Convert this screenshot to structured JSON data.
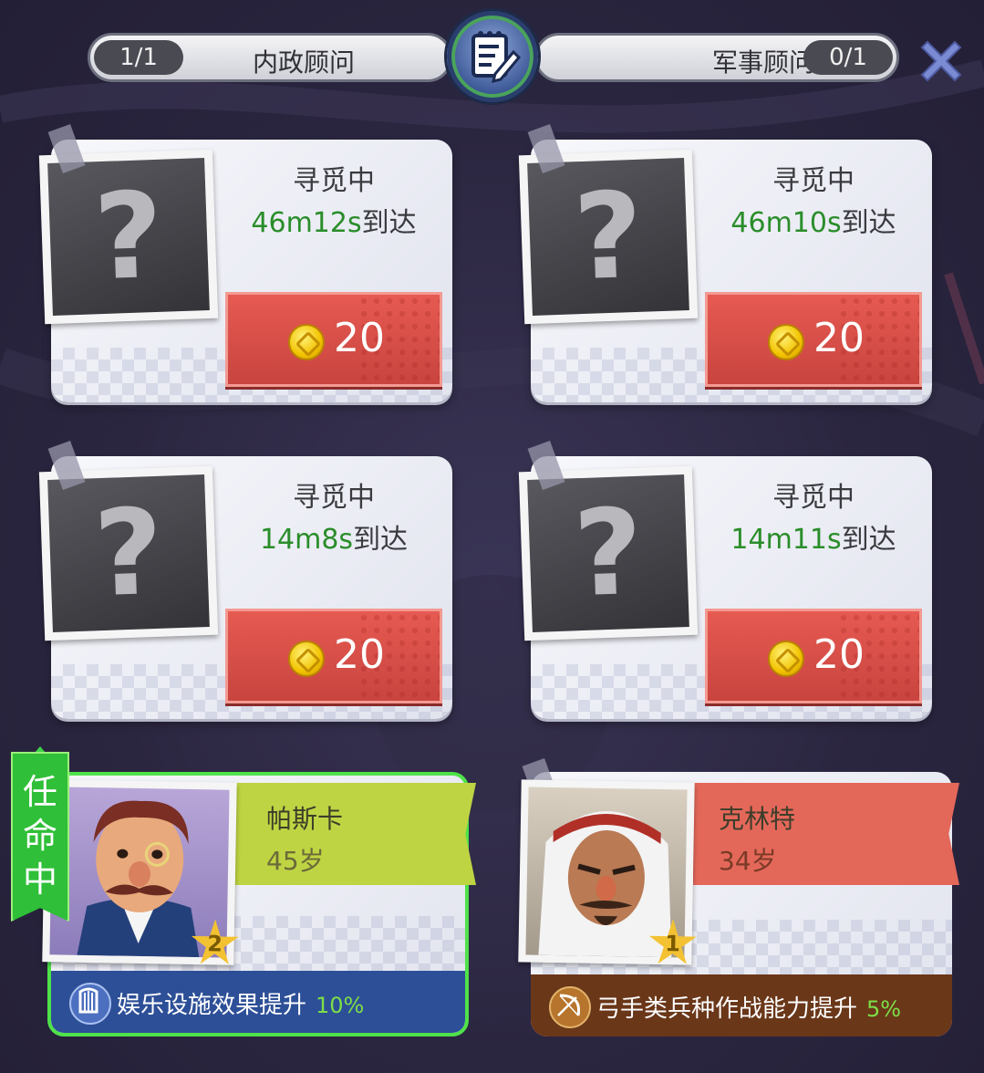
{
  "header": {
    "left_count": "1/1",
    "left_label": "内政顾问",
    "right_label": "军事顾问",
    "right_count": "0/1"
  },
  "search_slots": [
    {
      "status": "寻觅中",
      "time": "46m12s",
      "suffix": "到达",
      "cost": "20"
    },
    {
      "status": "寻觅中",
      "time": "46m10s",
      "suffix": "到达",
      "cost": "20"
    },
    {
      "status": "寻觅中",
      "time": "14m8s",
      "suffix": "到达",
      "cost": "20"
    },
    {
      "status": "寻觅中",
      "time": "14m11s",
      "suffix": "到达",
      "cost": "20"
    }
  ],
  "advisors": [
    {
      "name": "帕斯卡",
      "age": "45岁",
      "level": "2",
      "effect": "娱乐设施效果提升",
      "effect_pct": "10%",
      "appointed_label": "任命中",
      "ribbon_color": "#bfd443",
      "bar_color": "#2d4f97",
      "icon": "harp-icon"
    },
    {
      "name": "克林特",
      "age": "34岁",
      "level": "1",
      "effect": "弓手类兵种作战能力提升",
      "effect_pct": "5%",
      "ribbon_color": "#e4685a",
      "bar_color": "#6a3719",
      "icon": "bow-icon"
    }
  ],
  "colors": {
    "eta_green": "#2a8d2a",
    "cost_red": "#d94c46",
    "appointed_green": "#2fbf38"
  }
}
